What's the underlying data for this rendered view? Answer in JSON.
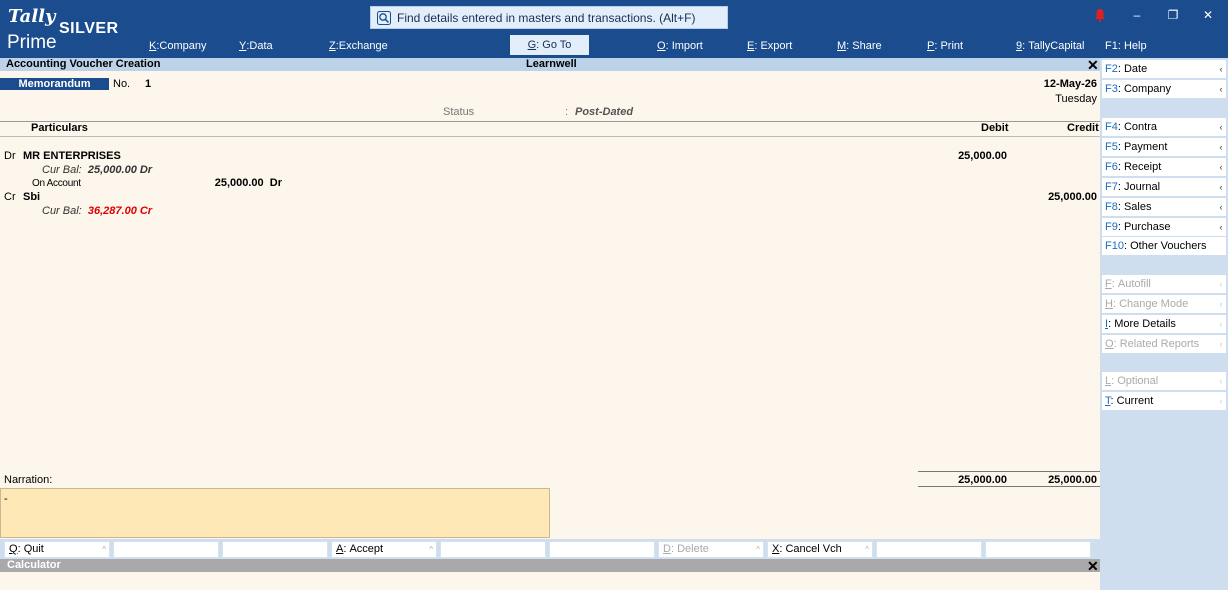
{
  "app": {
    "logo_top": "Tally",
    "logo_edition": "SILVER",
    "logo_bottom": "Prime"
  },
  "search": {
    "text": "Find details entered in masters and transactions. (Alt+F)"
  },
  "menu": [
    {
      "key": "K",
      "label": "Company"
    },
    {
      "key": "Y",
      "label": "Data"
    },
    {
      "key": "Z",
      "label": "Exchange"
    },
    {
      "key": "G",
      "label": "Go To"
    },
    {
      "key": "O",
      "label": "Import"
    },
    {
      "key": "E",
      "label": "Export"
    },
    {
      "key": "M",
      "label": "Share"
    },
    {
      "key": "P",
      "label": "Print"
    },
    {
      "key": "9",
      "label": "TallyCapital"
    },
    {
      "key": "F1",
      "label": "Help"
    }
  ],
  "window_controls": {
    "minimize": "–",
    "restore": "❐",
    "close": "✕"
  },
  "screen": {
    "title": "Accounting Voucher Creation",
    "company": "Learnwell"
  },
  "voucher": {
    "type": "Memorandum",
    "no_label": "No.",
    "no": "1",
    "date": "12-May-26",
    "day": "Tuesday",
    "status_label": "Status",
    "status_colon": ":",
    "status_value": "Post-Dated"
  },
  "columns": {
    "particulars": "Particulars",
    "debit": "Debit",
    "credit": "Credit"
  },
  "entries": [
    {
      "drcr": "Dr",
      "ledger": "MR ENTERPRISES",
      "curbal_label": "Cur Bal:",
      "curbal": "25,000.00 Dr",
      "bill_ref": "On Account",
      "bill_amount": "25,000.00",
      "bill_drcr": "Dr",
      "debit": "25,000.00",
      "credit": ""
    },
    {
      "drcr": "Cr",
      "ledger": "Sbi",
      "curbal_label": "Cur Bal:",
      "curbal": "36,287.00 Cr",
      "debit": "",
      "credit": "25,000.00"
    }
  ],
  "narration": {
    "label": "Narration:",
    "text": "-"
  },
  "totals": {
    "debit": "25,000.00",
    "credit": "25,000.00"
  },
  "bottom_buttons": [
    {
      "key": "Q",
      "label": "Quit",
      "enabled": true
    },
    {
      "key": "",
      "label": "",
      "enabled": false
    },
    {
      "key": "",
      "label": "",
      "enabled": false
    },
    {
      "key": "A",
      "label": "Accept",
      "enabled": true
    },
    {
      "key": "",
      "label": "",
      "enabled": false
    },
    {
      "key": "",
      "label": "",
      "enabled": false
    },
    {
      "key": "D",
      "label": "Delete",
      "enabled": false
    },
    {
      "key": "X",
      "label": "Cancel Vch",
      "enabled": true
    },
    {
      "key": "",
      "label": "",
      "enabled": false
    },
    {
      "key": "",
      "label": "",
      "enabled": false
    }
  ],
  "calculator": {
    "title": "Calculator"
  },
  "right_panel": [
    {
      "key": "F2",
      "label": "Date",
      "enabled": true
    },
    {
      "key": "F3",
      "label": "Company",
      "enabled": true
    },
    {
      "key": "F4",
      "label": "Contra",
      "enabled": true
    },
    {
      "key": "F5",
      "label": "Payment",
      "enabled": true
    },
    {
      "key": "F6",
      "label": "Receipt",
      "enabled": true
    },
    {
      "key": "F7",
      "label": "Journal",
      "enabled": true
    },
    {
      "key": "F8",
      "label": "Sales",
      "enabled": true
    },
    {
      "key": "F9",
      "label": "Purchase",
      "enabled": true
    },
    {
      "key": "F10",
      "label": "Other Vouchers",
      "enabled": true
    },
    {
      "key": "F",
      "label": "Autofill",
      "enabled": false
    },
    {
      "key": "H",
      "label": "Change Mode",
      "enabled": false
    },
    {
      "key": "I",
      "label": "More Details",
      "enabled": true
    },
    {
      "key": "O",
      "label": "Related Reports",
      "enabled": false
    },
    {
      "key": "L",
      "label": "Optional",
      "enabled": false
    },
    {
      "key": "T",
      "label": "Current",
      "enabled": true
    }
  ]
}
